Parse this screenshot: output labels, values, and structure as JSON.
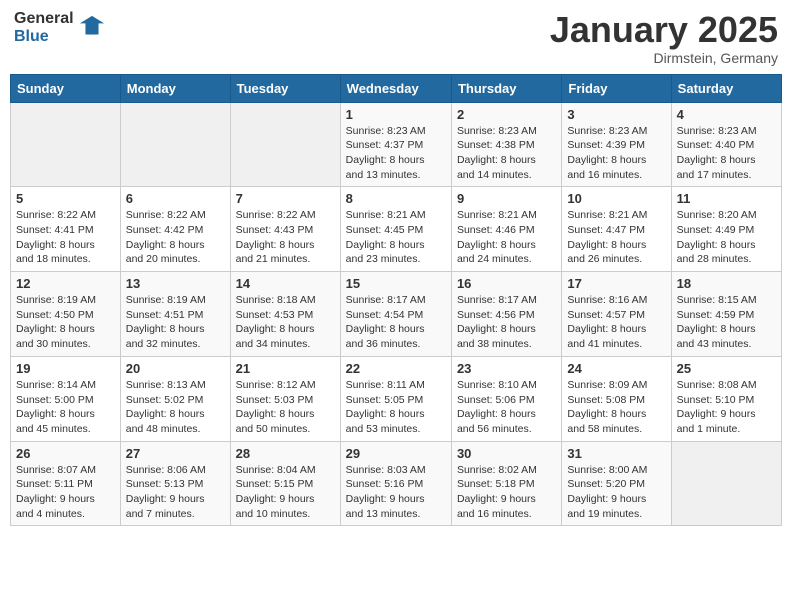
{
  "header": {
    "logo_general": "General",
    "logo_blue": "Blue",
    "month_title": "January 2025",
    "location": "Dirmstein, Germany"
  },
  "weekdays": [
    "Sunday",
    "Monday",
    "Tuesday",
    "Wednesday",
    "Thursday",
    "Friday",
    "Saturday"
  ],
  "weeks": [
    [
      {
        "day": "",
        "info": ""
      },
      {
        "day": "",
        "info": ""
      },
      {
        "day": "",
        "info": ""
      },
      {
        "day": "1",
        "info": "Sunrise: 8:23 AM\nSunset: 4:37 PM\nDaylight: 8 hours\nand 13 minutes."
      },
      {
        "day": "2",
        "info": "Sunrise: 8:23 AM\nSunset: 4:38 PM\nDaylight: 8 hours\nand 14 minutes."
      },
      {
        "day": "3",
        "info": "Sunrise: 8:23 AM\nSunset: 4:39 PM\nDaylight: 8 hours\nand 16 minutes."
      },
      {
        "day": "4",
        "info": "Sunrise: 8:23 AM\nSunset: 4:40 PM\nDaylight: 8 hours\nand 17 minutes."
      }
    ],
    [
      {
        "day": "5",
        "info": "Sunrise: 8:22 AM\nSunset: 4:41 PM\nDaylight: 8 hours\nand 18 minutes."
      },
      {
        "day": "6",
        "info": "Sunrise: 8:22 AM\nSunset: 4:42 PM\nDaylight: 8 hours\nand 20 minutes."
      },
      {
        "day": "7",
        "info": "Sunrise: 8:22 AM\nSunset: 4:43 PM\nDaylight: 8 hours\nand 21 minutes."
      },
      {
        "day": "8",
        "info": "Sunrise: 8:21 AM\nSunset: 4:45 PM\nDaylight: 8 hours\nand 23 minutes."
      },
      {
        "day": "9",
        "info": "Sunrise: 8:21 AM\nSunset: 4:46 PM\nDaylight: 8 hours\nand 24 minutes."
      },
      {
        "day": "10",
        "info": "Sunrise: 8:21 AM\nSunset: 4:47 PM\nDaylight: 8 hours\nand 26 minutes."
      },
      {
        "day": "11",
        "info": "Sunrise: 8:20 AM\nSunset: 4:49 PM\nDaylight: 8 hours\nand 28 minutes."
      }
    ],
    [
      {
        "day": "12",
        "info": "Sunrise: 8:19 AM\nSunset: 4:50 PM\nDaylight: 8 hours\nand 30 minutes."
      },
      {
        "day": "13",
        "info": "Sunrise: 8:19 AM\nSunset: 4:51 PM\nDaylight: 8 hours\nand 32 minutes."
      },
      {
        "day": "14",
        "info": "Sunrise: 8:18 AM\nSunset: 4:53 PM\nDaylight: 8 hours\nand 34 minutes."
      },
      {
        "day": "15",
        "info": "Sunrise: 8:17 AM\nSunset: 4:54 PM\nDaylight: 8 hours\nand 36 minutes."
      },
      {
        "day": "16",
        "info": "Sunrise: 8:17 AM\nSunset: 4:56 PM\nDaylight: 8 hours\nand 38 minutes."
      },
      {
        "day": "17",
        "info": "Sunrise: 8:16 AM\nSunset: 4:57 PM\nDaylight: 8 hours\nand 41 minutes."
      },
      {
        "day": "18",
        "info": "Sunrise: 8:15 AM\nSunset: 4:59 PM\nDaylight: 8 hours\nand 43 minutes."
      }
    ],
    [
      {
        "day": "19",
        "info": "Sunrise: 8:14 AM\nSunset: 5:00 PM\nDaylight: 8 hours\nand 45 minutes."
      },
      {
        "day": "20",
        "info": "Sunrise: 8:13 AM\nSunset: 5:02 PM\nDaylight: 8 hours\nand 48 minutes."
      },
      {
        "day": "21",
        "info": "Sunrise: 8:12 AM\nSunset: 5:03 PM\nDaylight: 8 hours\nand 50 minutes."
      },
      {
        "day": "22",
        "info": "Sunrise: 8:11 AM\nSunset: 5:05 PM\nDaylight: 8 hours\nand 53 minutes."
      },
      {
        "day": "23",
        "info": "Sunrise: 8:10 AM\nSunset: 5:06 PM\nDaylight: 8 hours\nand 56 minutes."
      },
      {
        "day": "24",
        "info": "Sunrise: 8:09 AM\nSunset: 5:08 PM\nDaylight: 8 hours\nand 58 minutes."
      },
      {
        "day": "25",
        "info": "Sunrise: 8:08 AM\nSunset: 5:10 PM\nDaylight: 9 hours\nand 1 minute."
      }
    ],
    [
      {
        "day": "26",
        "info": "Sunrise: 8:07 AM\nSunset: 5:11 PM\nDaylight: 9 hours\nand 4 minutes."
      },
      {
        "day": "27",
        "info": "Sunrise: 8:06 AM\nSunset: 5:13 PM\nDaylight: 9 hours\nand 7 minutes."
      },
      {
        "day": "28",
        "info": "Sunrise: 8:04 AM\nSunset: 5:15 PM\nDaylight: 9 hours\nand 10 minutes."
      },
      {
        "day": "29",
        "info": "Sunrise: 8:03 AM\nSunset: 5:16 PM\nDaylight: 9 hours\nand 13 minutes."
      },
      {
        "day": "30",
        "info": "Sunrise: 8:02 AM\nSunset: 5:18 PM\nDaylight: 9 hours\nand 16 minutes."
      },
      {
        "day": "31",
        "info": "Sunrise: 8:00 AM\nSunset: 5:20 PM\nDaylight: 9 hours\nand 19 minutes."
      },
      {
        "day": "",
        "info": ""
      }
    ]
  ]
}
